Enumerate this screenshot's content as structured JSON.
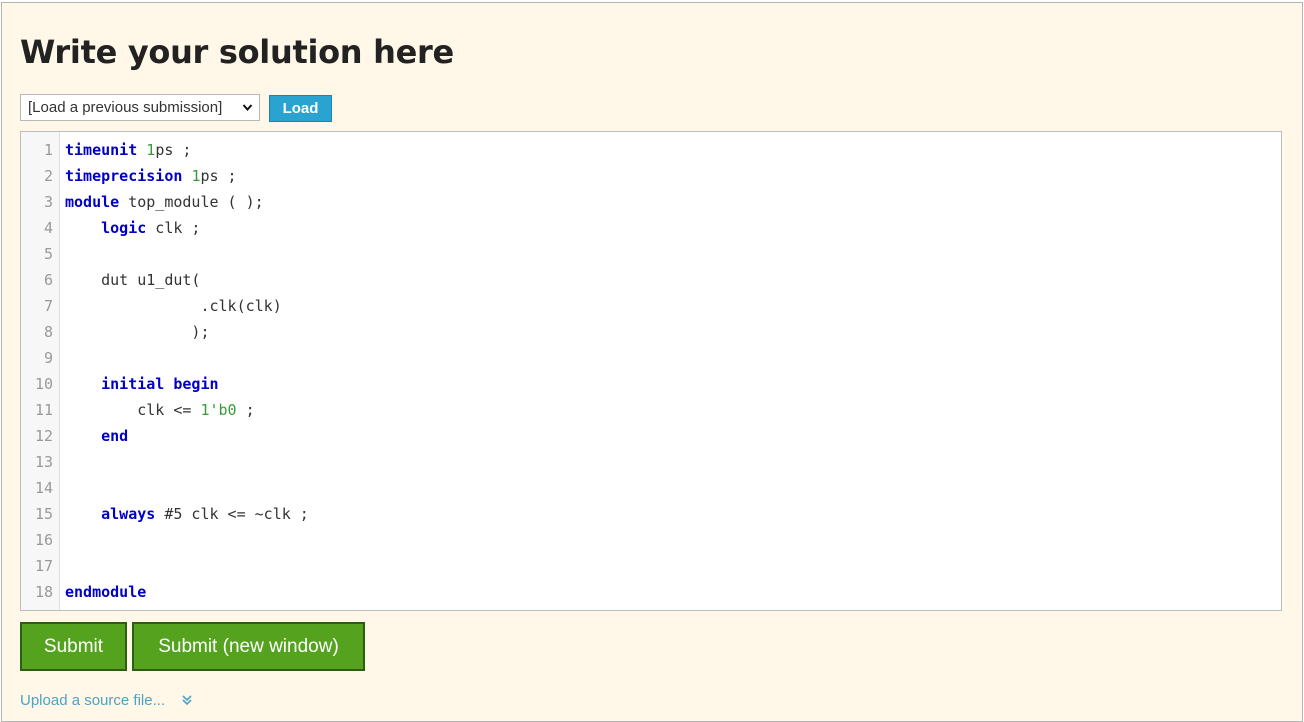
{
  "heading": "Write your solution here",
  "submission_select": {
    "selected": "[Load a previous submission]"
  },
  "load_label": "Load",
  "editor": {
    "lines": [
      {
        "n": "1",
        "tokens": [
          {
            "t": "timeunit",
            "c": "kw"
          },
          {
            "t": " ",
            "c": ""
          },
          {
            "t": "1",
            "c": "num"
          },
          {
            "t": "ps ;",
            "c": ""
          }
        ]
      },
      {
        "n": "2",
        "tokens": [
          {
            "t": "timeprecision",
            "c": "kw"
          },
          {
            "t": " ",
            "c": ""
          },
          {
            "t": "1",
            "c": "num"
          },
          {
            "t": "ps ;",
            "c": ""
          }
        ]
      },
      {
        "n": "3",
        "tokens": [
          {
            "t": "module",
            "c": "kw"
          },
          {
            "t": " top_module ( );",
            "c": ""
          }
        ]
      },
      {
        "n": "4",
        "tokens": [
          {
            "t": "    ",
            "c": ""
          },
          {
            "t": "logic",
            "c": "kw"
          },
          {
            "t": " clk ;",
            "c": ""
          }
        ]
      },
      {
        "n": "5",
        "tokens": []
      },
      {
        "n": "6",
        "tokens": [
          {
            "t": "    dut u1_dut(",
            "c": ""
          }
        ]
      },
      {
        "n": "7",
        "tokens": [
          {
            "t": "               .clk(clk)",
            "c": ""
          }
        ]
      },
      {
        "n": "8",
        "tokens": [
          {
            "t": "              );",
            "c": ""
          }
        ]
      },
      {
        "n": "9",
        "tokens": []
      },
      {
        "n": "10",
        "tokens": [
          {
            "t": "    ",
            "c": ""
          },
          {
            "t": "initial",
            "c": "kw"
          },
          {
            "t": " ",
            "c": ""
          },
          {
            "t": "begin",
            "c": "kw"
          }
        ]
      },
      {
        "n": "11",
        "tokens": [
          {
            "t": "        clk <= ",
            "c": ""
          },
          {
            "t": "1'b0",
            "c": "num"
          },
          {
            "t": " ;",
            "c": ""
          }
        ]
      },
      {
        "n": "12",
        "tokens": [
          {
            "t": "    ",
            "c": ""
          },
          {
            "t": "end",
            "c": "kw"
          }
        ]
      },
      {
        "n": "13",
        "tokens": []
      },
      {
        "n": "14",
        "tokens": []
      },
      {
        "n": "15",
        "tokens": [
          {
            "t": "    ",
            "c": ""
          },
          {
            "t": "always",
            "c": "kw"
          },
          {
            "t": " #5 clk <= ~clk ;",
            "c": ""
          }
        ]
      },
      {
        "n": "16",
        "tokens": []
      },
      {
        "n": "17",
        "tokens": []
      },
      {
        "n": "18",
        "tokens": [
          {
            "t": "endmodule",
            "c": "kw"
          }
        ]
      }
    ]
  },
  "submit_label": "Submit",
  "submit_new_window_label": "Submit (new window)",
  "upload_label": "Upload a source file...",
  "upload_icon": "double-chevron-down-icon",
  "colors": {
    "panel_bg": "#fff7e7",
    "load_button": "#29a3cf",
    "submit_button": "#55a21f",
    "keyword": "#0000c8",
    "number": "#3a9a3a",
    "link": "#4aa3c8"
  }
}
